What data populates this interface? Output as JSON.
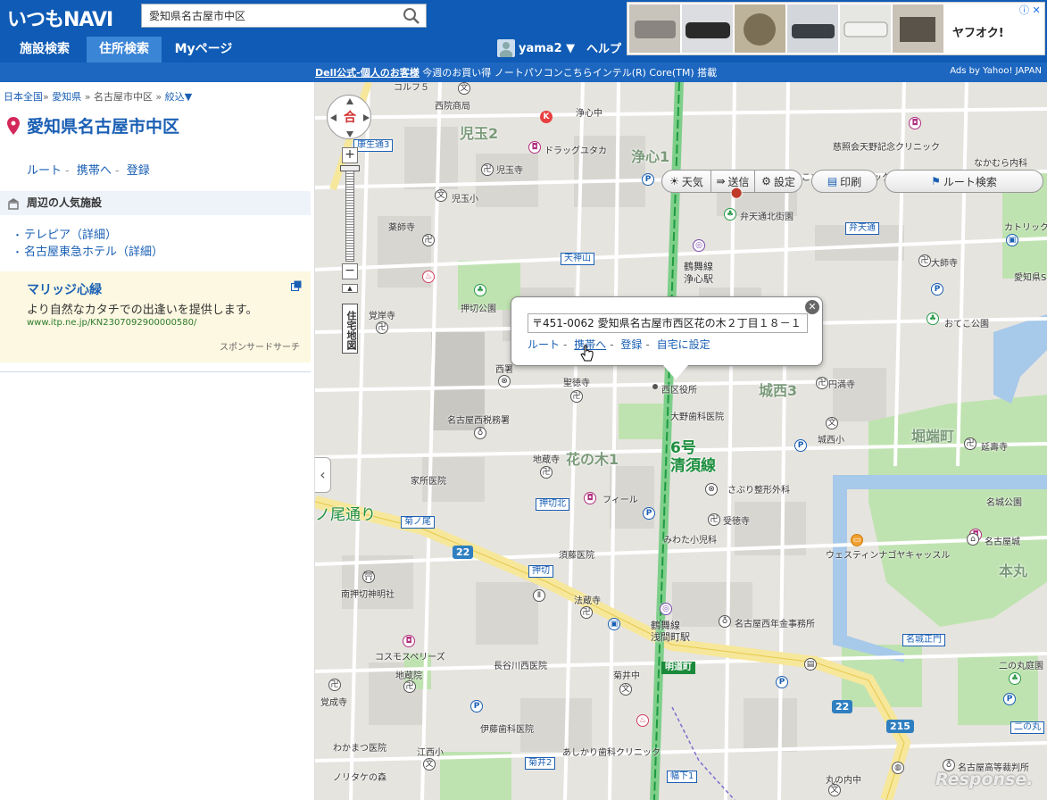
{
  "header": {
    "logo": "いつもNAVI",
    "search_value": "愛知県名古屋市中区",
    "tabs": [
      {
        "label": "施設検索"
      },
      {
        "label": "住所検索"
      },
      {
        "label": "Myページ"
      }
    ],
    "user": "yama2 ▼",
    "help": "ヘルプ",
    "ads_info": "ⓘ ✕"
  },
  "adbar": {
    "bold": "Dell公式-個人のお客様",
    "text": " 今週のお買い得 ノートパソコンこちらインテル(R) Core(TM) 搭載",
    "by": "Ads by Yahoo! JAPAN"
  },
  "sidebar": {
    "breadcrumb": [
      "日本全国",
      "愛知県",
      "名古屋市中区",
      "絞込▼"
    ],
    "title": "愛知県名古屋市中区",
    "links": [
      "ルート",
      "携帯へ",
      "登録"
    ],
    "popular_heading": "周辺の人気施設",
    "popular": [
      "テレピア（詳細）",
      "名古屋東急ホテル（詳細）"
    ],
    "sponsor": {
      "title": "マリッジ心緑",
      "desc": "より自然なカタチでの出逢いを提供します。",
      "url": "www.itp.ne.jp/KN2307092900000580/",
      "label": "スポンサードサーチ"
    }
  },
  "toolbar": {
    "weather": "天気",
    "send": "送信",
    "settings": "設定",
    "print": "印刷",
    "route_search": "ルート検索"
  },
  "map_controls": {
    "home_glyph": "合",
    "zoom_in": "+",
    "zoom_out": "−",
    "zoom_up": "▲",
    "jutaku": "住宅地図",
    "collapse": "‹"
  },
  "popup": {
    "address": "〒451-0062 愛知県名古屋市西区花の木２丁目１８－１",
    "links": [
      "ルート",
      "携帯へ",
      "登録",
      "自宅に設定"
    ],
    "close": "✕"
  },
  "map": {
    "labels": [
      {
        "t": "コルフ５"
      },
      {
        "t": "西院商局"
      },
      {
        "t": "浄心中"
      },
      {
        "t": "児玉2"
      },
      {
        "t": "ドラッグユタカ"
      },
      {
        "t": "浄心1"
      },
      {
        "t": "児玉寺"
      },
      {
        "t": "慈照会天野記念クリニック"
      },
      {
        "t": "なかむら内科"
      },
      {
        "t": "こざき女性クリニック"
      },
      {
        "t": "児玉小"
      },
      {
        "t": "薬師寺"
      },
      {
        "t": "弁天通北街園"
      },
      {
        "t": "カトリック教"
      },
      {
        "t": "鶴舞線"
      },
      {
        "t": "浄心駅"
      },
      {
        "t": "大師寺"
      },
      {
        "t": "愛知県S"
      },
      {
        "t": "押切公園"
      },
      {
        "t": "覚岸寺"
      },
      {
        "t": "おてこ公園"
      },
      {
        "t": "西署"
      },
      {
        "t": "聖徳寺"
      },
      {
        "t": "西区役所"
      },
      {
        "t": "城西3"
      },
      {
        "t": "円満寺"
      },
      {
        "t": "名古屋西税務署"
      },
      {
        "t": "大野歯科医院"
      },
      {
        "t": "城西小"
      },
      {
        "t": "堀端町"
      },
      {
        "t": "延壽寺"
      },
      {
        "t": "花の木1"
      },
      {
        "t": "地蔵寺"
      },
      {
        "t": "家所医院"
      },
      {
        "t": "さぶり整形外科"
      },
      {
        "t": "名城公園"
      },
      {
        "t": "フィール"
      },
      {
        "t": "受徳寺"
      },
      {
        "t": "名古屋城"
      },
      {
        "t": "みわた小児科"
      },
      {
        "t": "ウェスティンナゴヤキャッスル"
      },
      {
        "t": "須藤医院"
      },
      {
        "t": "本丸"
      },
      {
        "t": "南押切神明社"
      },
      {
        "t": "法蔵寺"
      },
      {
        "t": "鶴舞線"
      },
      {
        "t": "浅間町駅"
      },
      {
        "t": "名古屋西年金事務所"
      },
      {
        "t": "コスモスペリーズ"
      },
      {
        "t": "長谷川西医院"
      },
      {
        "t": "菊井中"
      },
      {
        "t": "地蔵院"
      },
      {
        "t": "覚成寺"
      },
      {
        "t": "二の丸庭園"
      },
      {
        "t": "伊藤歯科医院"
      },
      {
        "t": "わかまつ医院"
      },
      {
        "t": "江西小"
      },
      {
        "t": "あしかり歯科クリニック"
      },
      {
        "t": "ノリタケの森"
      },
      {
        "t": "丸の内中"
      },
      {
        "t": "名古屋高等裁判所"
      }
    ],
    "route_label": "6号\n清須線",
    "street_label": "ノ尾通り",
    "signs": [
      {
        "t": "康生通3"
      },
      {
        "t": "天神山"
      },
      {
        "t": "弁天通"
      },
      {
        "t": "押切北"
      },
      {
        "t": "菊ノ尾"
      },
      {
        "t": "押切"
      },
      {
        "t": "明道町"
      },
      {
        "t": "名城正門"
      },
      {
        "t": "菊井2"
      },
      {
        "t": "幅下1"
      },
      {
        "t": "二の丸"
      }
    ],
    "route_numbers": [
      "22",
      "22",
      "215"
    ]
  },
  "watermark": "Response."
}
